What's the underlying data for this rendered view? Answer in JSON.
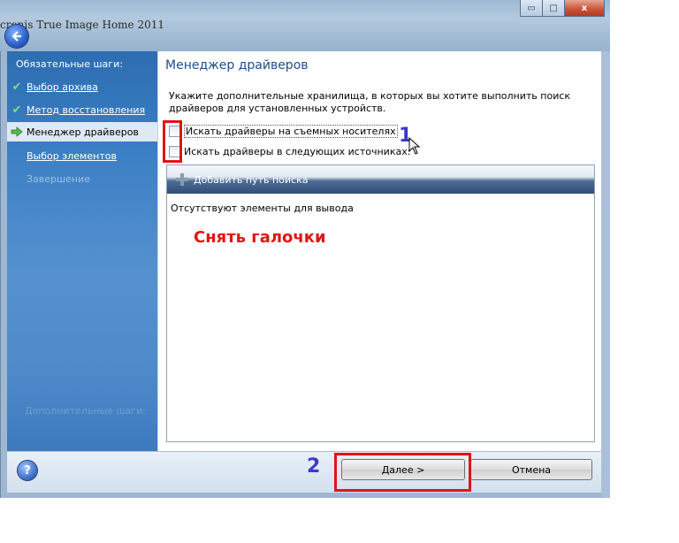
{
  "window": {
    "title": "cronis True Image Home 2011",
    "controls": {
      "minimize": "▭",
      "maximize": "□",
      "close": "x"
    }
  },
  "sidebar": {
    "header": "Обязательные шаги:",
    "items": [
      {
        "label": "Выбор архива",
        "state": "done"
      },
      {
        "label": "Метод восстановления",
        "state": "done"
      },
      {
        "label": "Менеджер драйверов",
        "state": "current"
      },
      {
        "label": "Выбор элементов",
        "state": "link"
      },
      {
        "label": "Завершение",
        "state": "disabled"
      }
    ],
    "optional_header": "Дополнительные шаги:"
  },
  "main": {
    "title": "Менеджер драйверов",
    "description": "Укажите дополнительные хранилища, в которых вы хотите выполнить поиск драйверов для установленных устройств.",
    "checkboxes": [
      {
        "label": "Искать драйверы на съемных носителях",
        "checked": false
      },
      {
        "label": "Искать драйверы в следующих источниках:",
        "checked": false
      }
    ],
    "list": {
      "add_button": "Добавить путь поиска",
      "empty_text": "Отсутствуют элементы для вывода"
    }
  },
  "footer": {
    "help": "?",
    "next_button": "Далее >",
    "cancel_button": "Отмена"
  },
  "annotations": {
    "marker1": "1",
    "marker2": "2",
    "note": "Снять галочки",
    "note_color": "#e01515",
    "marker_color": "#3a3ac8"
  }
}
